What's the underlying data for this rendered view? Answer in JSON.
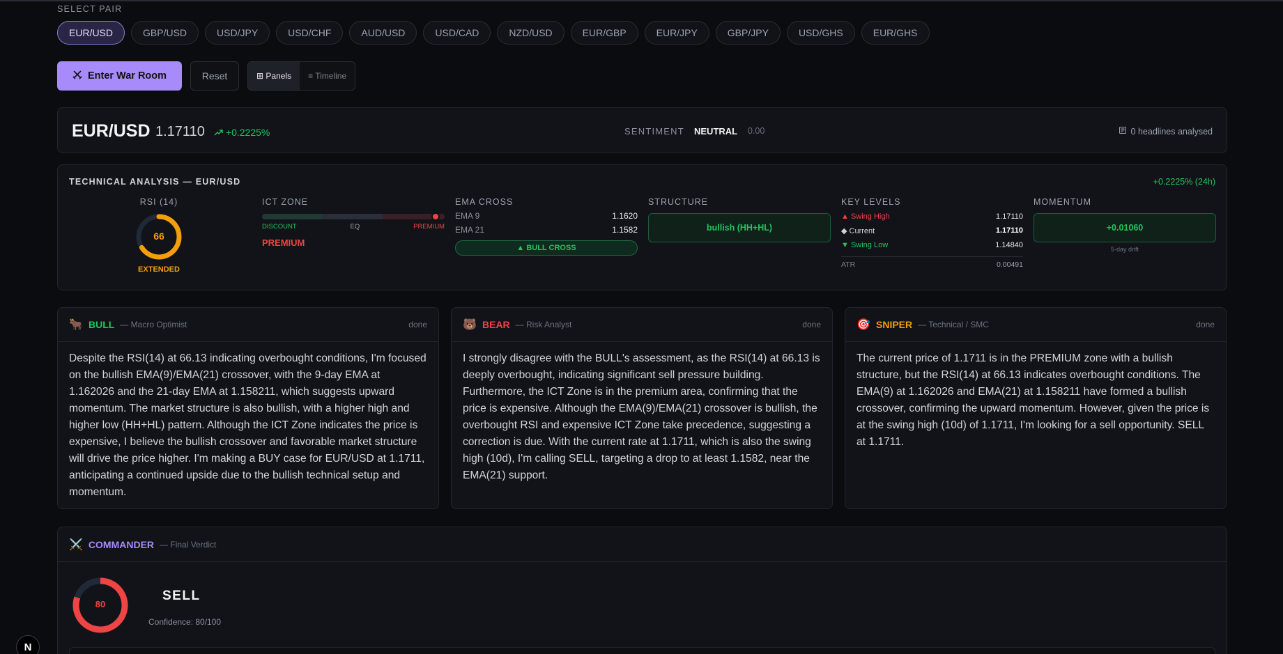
{
  "pair_selector": {
    "label": "SELECT PAIR",
    "pairs": [
      "EUR/USD",
      "GBP/USD",
      "USD/JPY",
      "USD/CHF",
      "AUD/USD",
      "USD/CAD",
      "NZD/USD",
      "EUR/GBP",
      "EUR/JPY",
      "GBP/JPY",
      "USD/GHS",
      "EUR/GHS"
    ],
    "selected": "EUR/USD"
  },
  "actions": {
    "war_room_label": "Enter War Room",
    "reset_label": "Reset",
    "view_panels": "⊞ Panels",
    "view_timeline": "≡ Timeline",
    "active_view": "Panels"
  },
  "header": {
    "pair": "EUR/USD",
    "price": "1.17110",
    "change": "+0.2225%",
    "sentiment_label": "SENTIMENT",
    "sentiment_value": "NEUTRAL",
    "sentiment_score": "0.00",
    "headlines": "0 headlines analysed"
  },
  "technical": {
    "title": "TECHNICAL ANALYSIS — EUR/USD",
    "change_24h": "+0.2225% (24h)",
    "rsi": {
      "label": "RSI (14)",
      "value": "66",
      "level": 66,
      "state": "EXTENDED"
    },
    "ict": {
      "label": "ICT ZONE",
      "discount": "DISCOUNT",
      "eq": "EQ",
      "premium": "PREMIUM",
      "zone": "PREMIUM",
      "position": 0.95
    },
    "ema": {
      "label": "EMA CROSS",
      "ema9_label": "EMA 9",
      "ema9": "1.1620",
      "ema21_label": "EMA 21",
      "ema21": "1.1582",
      "cross": "▲ BULL CROSS"
    },
    "structure": {
      "label": "STRUCTURE",
      "value": "bullish (HH+HL)"
    },
    "key_levels": {
      "label": "KEY LEVELS",
      "swing_high_label": "▲ Swing High",
      "swing_high": "1.17110",
      "current_label": "◆ Current",
      "current": "1.17110",
      "swing_low_label": "▼ Swing Low",
      "swing_low": "1.14840",
      "atr_label": "ATR",
      "atr": "0.00491"
    },
    "momentum": {
      "label": "MOMENTUM",
      "value": "+0.01060",
      "sub": "5-day drift"
    }
  },
  "agents": [
    {
      "emoji": "🐂",
      "name": "BULL",
      "role": "— Macro Optimist",
      "status": "done",
      "color": "#22c55e",
      "text": "Despite the RSI(14) at 66.13 indicating overbought conditions, I'm focused on the bullish EMA(9)/EMA(21) crossover, with the 9-day EMA at 1.162026 and the 21-day EMA at 1.158211, which suggests upward momentum. The market structure is also bullish, with a higher high and higher low (HH+HL) pattern. Although the ICT Zone indicates the price is expensive, I believe the bullish crossover and favorable market structure will drive the price higher. I'm making a BUY case for EUR/USD at 1.1711, anticipating a continued upside due to the bullish technical setup and momentum."
    },
    {
      "emoji": "🐻",
      "name": "BEAR",
      "role": "— Risk Analyst",
      "status": "done",
      "color": "#ef4444",
      "text": "I strongly disagree with the BULL's assessment, as the RSI(14) at 66.13 is deeply overbought, indicating significant sell pressure building. Furthermore, the ICT Zone is in the premium area, confirming that the price is expensive. Although the EMA(9)/EMA(21) crossover is bullish, the overbought RSI and expensive ICT Zone take precedence, suggesting a correction is due. With the current rate at 1.1711, which is also the swing high (10d), I'm calling SELL, targeting a drop to at least 1.1582, near the EMA(21) support."
    },
    {
      "emoji": "🎯",
      "name": "SNIPER",
      "role": "— Technical / SMC",
      "status": "done",
      "color": "#f59e0b",
      "text": "The current price of 1.1711 is in the PREMIUM zone with a bullish structure, but the RSI(14) at 66.13 indicates overbought conditions. The EMA(9) at 1.162026 and EMA(21) at 1.158211 have formed a bullish crossover, confirming the upward momentum. However, given the price is at the swing high (10d) of 1.1711, I'm looking for a sell opportunity. SELL at 1.1711."
    }
  ],
  "commander": {
    "emoji": "⚔️",
    "name": "COMMANDER",
    "role": "— Final Verdict",
    "confidence_value": "80",
    "confidence_level": 80,
    "verdict": "SELL",
    "confidence_text": "Confidence: 80/100"
  },
  "badge": "N"
}
